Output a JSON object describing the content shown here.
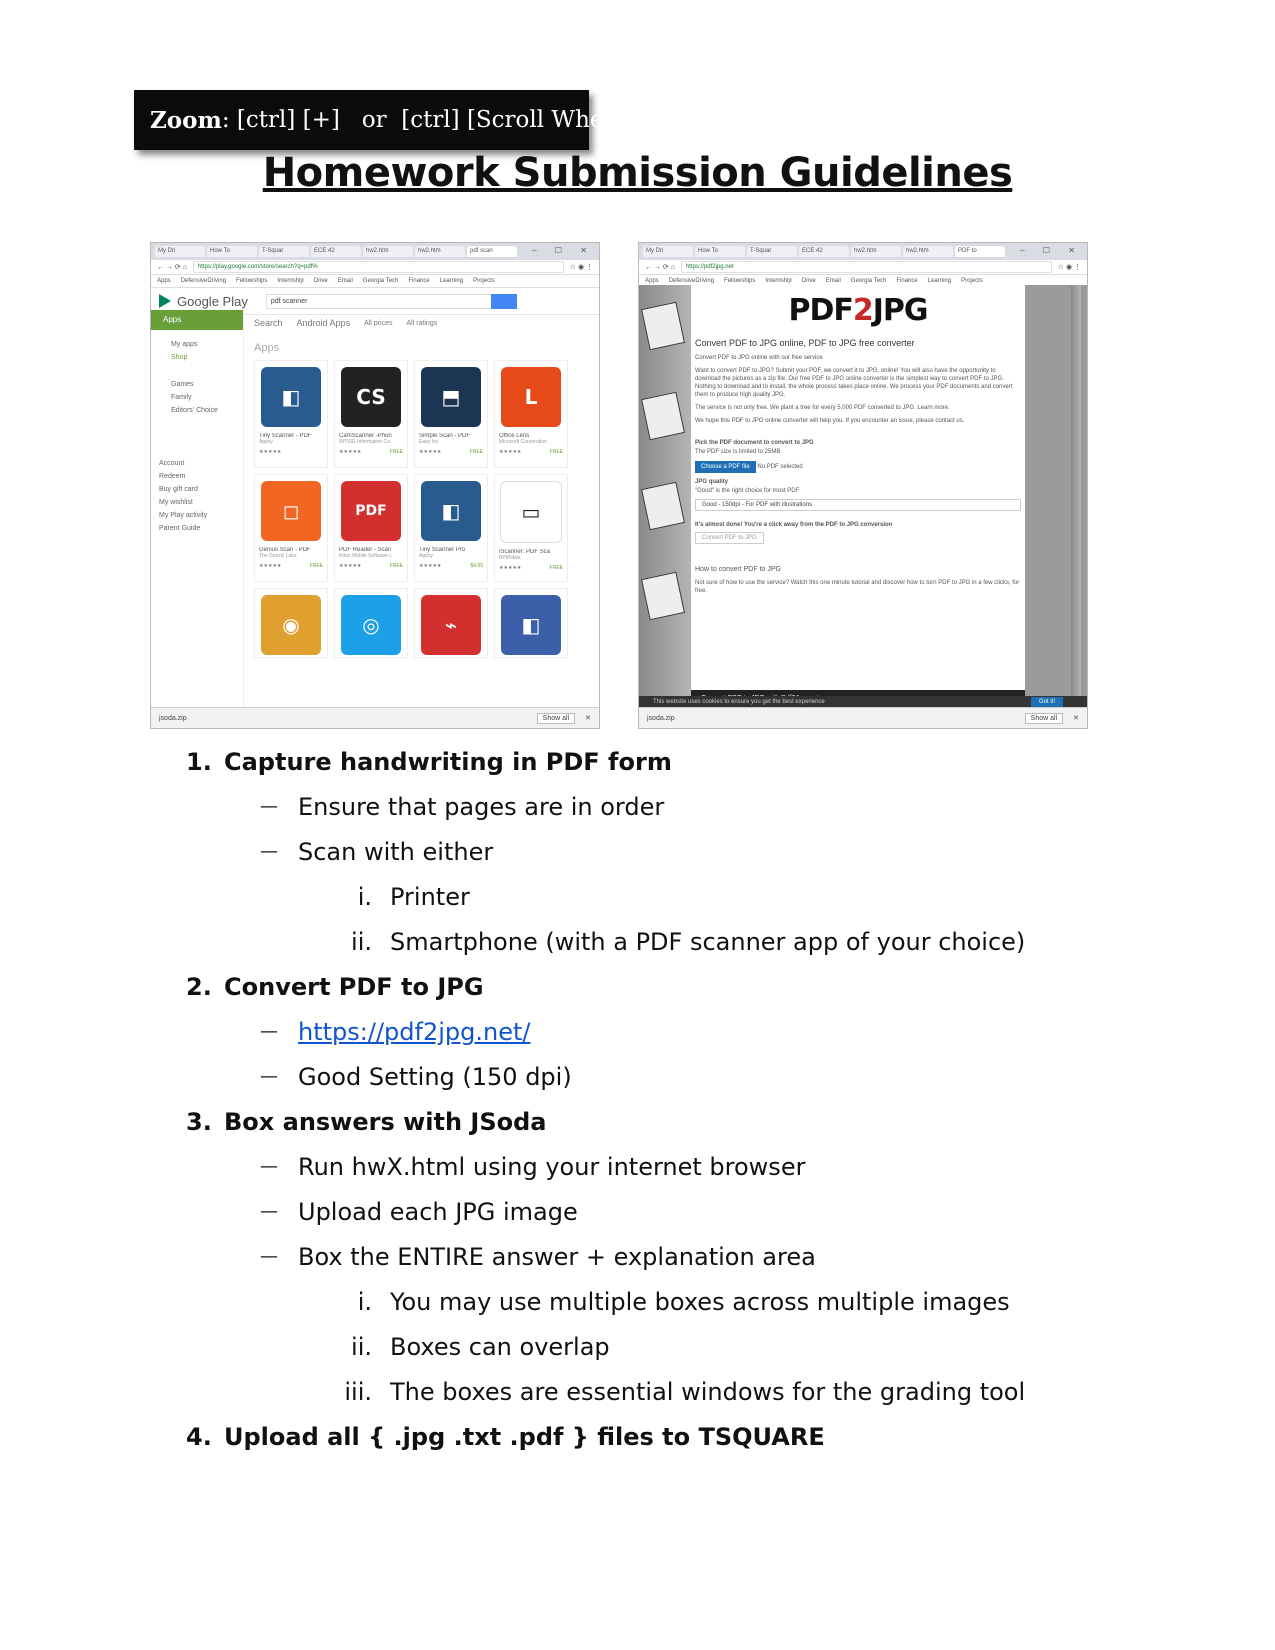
{
  "zoom_banner": {
    "label": "Zoom",
    "text": ": [ctrl] [+]   or  [ctrl] [Scroll Wheel]"
  },
  "title": "Homework Submission Guidelines",
  "screenshot_left": {
    "tabs": [
      "My Dri",
      "How To",
      "T-Squar",
      "ECE 42",
      "hw2.htm",
      "hw2.htm",
      "pdf scan"
    ],
    "url": "https://play.google.com/store/search?q=pdf%",
    "bookmarks": [
      "Apps",
      "DefensiveDriving",
      "Fellowships",
      "Internship",
      "Drive",
      "Email",
      "Georgia Tech",
      "Finance",
      "Learning",
      "Projects"
    ],
    "logo": "Google Play",
    "search_value": "pdf scanner",
    "side_tab": "Apps",
    "side_items": [
      "My apps",
      "Shop",
      "Games",
      "Family",
      "Editors' Choice",
      "Account",
      "Redeem",
      "Buy gift card",
      "My wishlist",
      "My Play activity",
      "Parent Guide"
    ],
    "nav": [
      "Search",
      "Android Apps",
      "All prices",
      "All ratings"
    ],
    "section": "Apps",
    "apps": [
      {
        "name": "Tiny Scanner - PDF",
        "dev": "Appxy",
        "price": ""
      },
      {
        "name": "CamScanner -Phon",
        "dev": "INTSIG Information Co.",
        "price": "FREE"
      },
      {
        "name": "Simple Scan - PDF",
        "dev": "Easy Inc",
        "price": "FREE"
      },
      {
        "name": "Office Lens",
        "dev": "Microsoft Corporation",
        "price": "FREE"
      },
      {
        "name": "Genius Scan - PDF",
        "dev": "The Grizzly Labs",
        "price": "FREE"
      },
      {
        "name": "PDF Reader - Scan",
        "dev": "Kdan Mobile Software L",
        "price": "FREE"
      },
      {
        "name": "Tiny Scanner Pro",
        "dev": "Appxy",
        "price": "$4.99"
      },
      {
        "name": "iScanner: PDF Sca",
        "dev": "BPMobile",
        "price": "FREE"
      }
    ],
    "download_file": "jsoda.zip",
    "show_all": "Show all"
  },
  "screenshot_right": {
    "tabs": [
      "My Dri",
      "How To",
      "T-Squar",
      "ECE 42",
      "hw2.htm",
      "hw2.htm",
      "PDF to"
    ],
    "url": "https://pdf2jpg.net",
    "bookmarks": [
      "Apps",
      "DefensiveDriving",
      "Fellowships",
      "Internship",
      "Drive",
      "Email",
      "Georgia Tech",
      "Finance",
      "Learning",
      "Projects"
    ],
    "logo_a": "PDF",
    "logo_b": "2",
    "logo_c": "JPG",
    "heading": "Convert PDF to JPG online, PDF to JPG free converter",
    "sub": "Convert PDF to JPG online with our free service",
    "p1": "Want to convert PDF to JPG? Submit your PDF, we convert it to JPG, online! You will also have the opportunity to download the pictures as a zip file. Our free PDF to JPG online converter is the simplest way to convert PDF to JPG. Nothing to download and to install, the whole process takes place online. We process your PDF documents and convert them to produce high quality JPG.",
    "p2": "The service is not only free. We plant a tree for every 5,000 PDF converted to JPG. Learn more.",
    "p3": "We hope this PDF to JPG online converter will help you. If you encounter an issue, please contact us.",
    "pick": "Pick the PDF document to convert to JPG",
    "limit": "The PDF size is limited to 25MB",
    "choose_btn": "Choose a PDF file",
    "no_file": "No PDF selected",
    "quality_label": "JPG quality",
    "quality_hint": "\"Good\" is the right choice for most PDF",
    "quality_value": "Good - 150dpi - For PDF with illustrations",
    "almost": "It's almost done! You're a click away from the PDF to JPG conversion",
    "convert_btn": "Convert PDF to JPG",
    "how_to": "How to convert PDF to JPG",
    "how_to_p": "Not sure of how to use the service? Watch this one minute tutorial and discover how to turn PDF to JPG in a few clicks, for free.",
    "video": "Convert PDF to JPG with Pdf2Jpg.net",
    "cookie": "This website uses cookies to ensure you get the best experience",
    "got_it": "Got it!",
    "download_file": "jsoda.zip",
    "show_all": "Show all"
  },
  "steps": [
    {
      "num": "1.",
      "text": "Capture handwriting in PDF form"
    },
    {
      "num": "2.",
      "text": "Convert PDF to JPG"
    },
    {
      "num": "3.",
      "text": "Box answers with JSoda"
    },
    {
      "num": "4.",
      "text": "Upload all { .jpg  .txt  .pdf } files to TSQUARE"
    }
  ],
  "step1_items": [
    "Ensure that pages are in order",
    "Scan with either"
  ],
  "step1_sub": [
    {
      "rn": "i.",
      "text": "Printer"
    },
    {
      "rn": "ii.",
      "text": "Smartphone (with a PDF scanner app of your choice)"
    }
  ],
  "step2_link": "https://pdf2jpg.net/",
  "step2_item": "Good Setting (150 dpi)",
  "step3_items": [
    "Run hwX.html using your internet browser",
    "Upload each JPG image",
    "Box the ENTIRE answer + explanation area"
  ],
  "step3_sub": [
    {
      "rn": "i.",
      "text": "You may use multiple boxes across multiple images"
    },
    {
      "rn": "ii.",
      "text": "Boxes can overlap"
    },
    {
      "rn": "iii.",
      "text": "The boxes are essential windows for the grading tool"
    }
  ],
  "dash": "—",
  "colors": {
    "link": "#1155cc",
    "banner_bg": "#0b0b0b",
    "play_green": "#689f38",
    "pdf_red": "#c62828"
  }
}
